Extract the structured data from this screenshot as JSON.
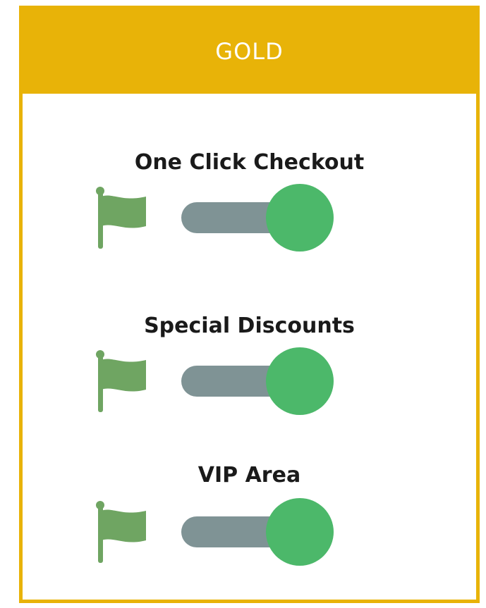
{
  "plan": {
    "title": "GOLD"
  },
  "colors": {
    "accent": "#E8B308",
    "knob": "#4CB86A",
    "track": "#7F9395",
    "flag": "#6FA562"
  },
  "features": [
    {
      "label": "One Click Checkout",
      "enabled": true,
      "icon": "flag-icon"
    },
    {
      "label": "Special Discounts",
      "enabled": true,
      "icon": "flag-icon"
    },
    {
      "label": "VIP Area",
      "enabled": true,
      "icon": "flag-icon"
    }
  ]
}
